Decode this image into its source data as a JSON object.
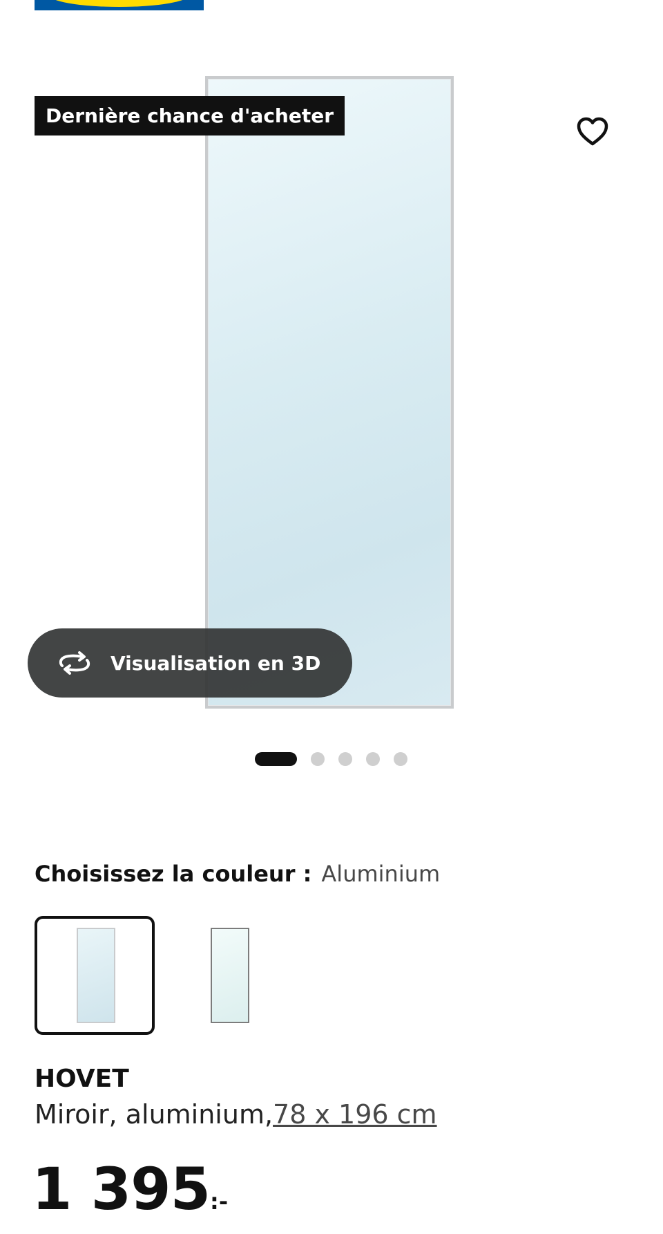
{
  "product": {
    "badge": "Dernière chance d'acheter",
    "view3d_label": "Visualisation en 3D",
    "image_count": 5,
    "active_image_index": 0,
    "color_label": "Choisissez la couleur :",
    "color_value": "Aluminium",
    "name": "HOVET",
    "description": "Miroir, aluminium,",
    "size_link": "78 x 196 cm",
    "price_integer": "1 395",
    "price_suffix": ":-"
  },
  "icons": {
    "favourite": "heart-outline-icon",
    "view3d": "rotate-3d-icon"
  },
  "colors": {
    "brand_blue": "#0058a3",
    "brand_yellow": "#ffdb00",
    "badge_bg": "#111111",
    "button_bg": "#333535",
    "dot_active": "#111111",
    "dot_inactive": "#cfcfcf"
  }
}
